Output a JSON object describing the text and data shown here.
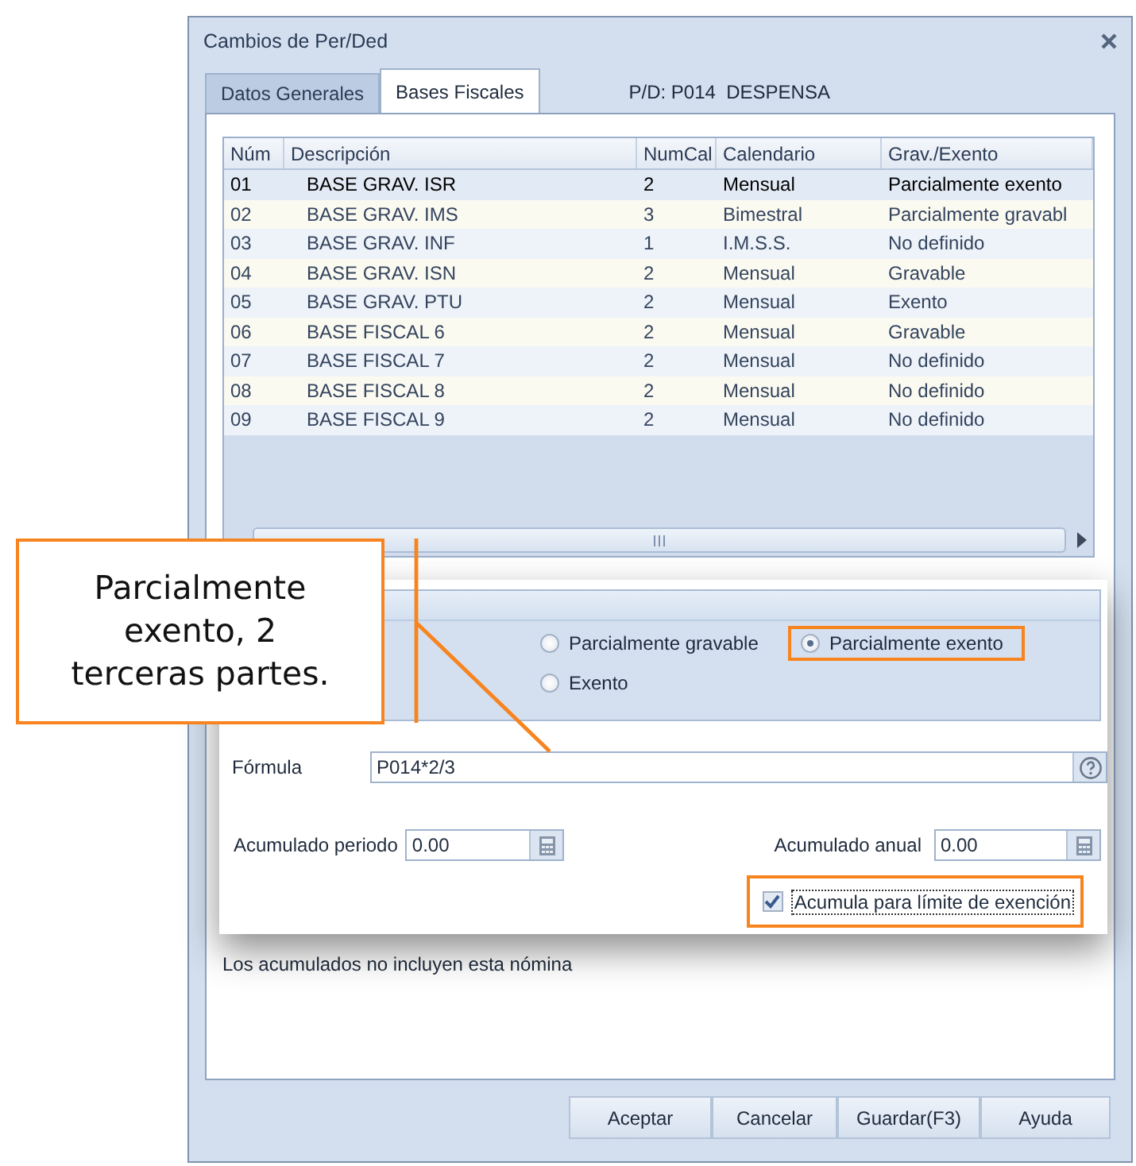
{
  "window": {
    "title": "Cambios de Per/Ded"
  },
  "tabs": [
    {
      "label": "Datos Generales",
      "selected": false
    },
    {
      "label": "Bases Fiscales",
      "selected": true
    }
  ],
  "record_label": "P/D: P014  DESPENSA",
  "table": {
    "columns": [
      "Núm",
      "Descripción",
      "NumCal",
      "Calendario",
      "Grav./Exento"
    ],
    "rows": [
      {
        "cells": [
          "01",
          "BASE GRAV. ISR",
          "2",
          "Mensual",
          "Parcialmente exento"
        ],
        "selected": true
      },
      {
        "cells": [
          "02",
          "BASE GRAV. IMS",
          "3",
          "Bimestral",
          "Parcialmente gravabl"
        ],
        "selected": false
      },
      {
        "cells": [
          "03",
          "BASE GRAV. INF",
          "1",
          "I.M.S.S.",
          "No definido"
        ],
        "selected": false
      },
      {
        "cells": [
          "04",
          "BASE GRAV. ISN",
          "2",
          "Mensual",
          "Gravable"
        ],
        "selected": false
      },
      {
        "cells": [
          "05",
          "BASE GRAV. PTU",
          "2",
          "Mensual",
          "Exento"
        ],
        "selected": false
      },
      {
        "cells": [
          "06",
          "BASE FISCAL 6",
          "2",
          "Mensual",
          "Gravable"
        ],
        "selected": false
      },
      {
        "cells": [
          "07",
          "BASE FISCAL 7",
          "2",
          "Mensual",
          "No definido"
        ],
        "selected": false
      },
      {
        "cells": [
          "08",
          "BASE FISCAL 8",
          "2",
          "Mensual",
          "No definido"
        ],
        "selected": false
      },
      {
        "cells": [
          "09",
          "BASE FISCAL 9",
          "2",
          "Mensual",
          "No definido"
        ],
        "selected": false
      }
    ]
  },
  "callout": {
    "text": "Parcialmente exento, 2 terceras partes."
  },
  "detail": {
    "radios": [
      {
        "label": "Parcialmente gravable",
        "selected": false,
        "highlighted": false
      },
      {
        "label": "Parcialmente exento",
        "selected": true,
        "highlighted": true
      },
      {
        "label": "Exento",
        "selected": false,
        "highlighted": false
      }
    ],
    "formula": {
      "label": "Fórmula",
      "value": "P014*2/3"
    },
    "fields": [
      {
        "label": "Acumulado periodo",
        "value": "0.00"
      },
      {
        "label": "Acumulado anual",
        "value": "0.00"
      }
    ],
    "checkbox": {
      "label": "Acumula para límite de exención",
      "checked": true,
      "highlighted": true
    }
  },
  "status_text": "Los acumulados no incluyen esta nómina",
  "buttons": [
    "Aceptar",
    "Cancelar",
    "Guardar(F3)",
    "Ayuda"
  ]
}
